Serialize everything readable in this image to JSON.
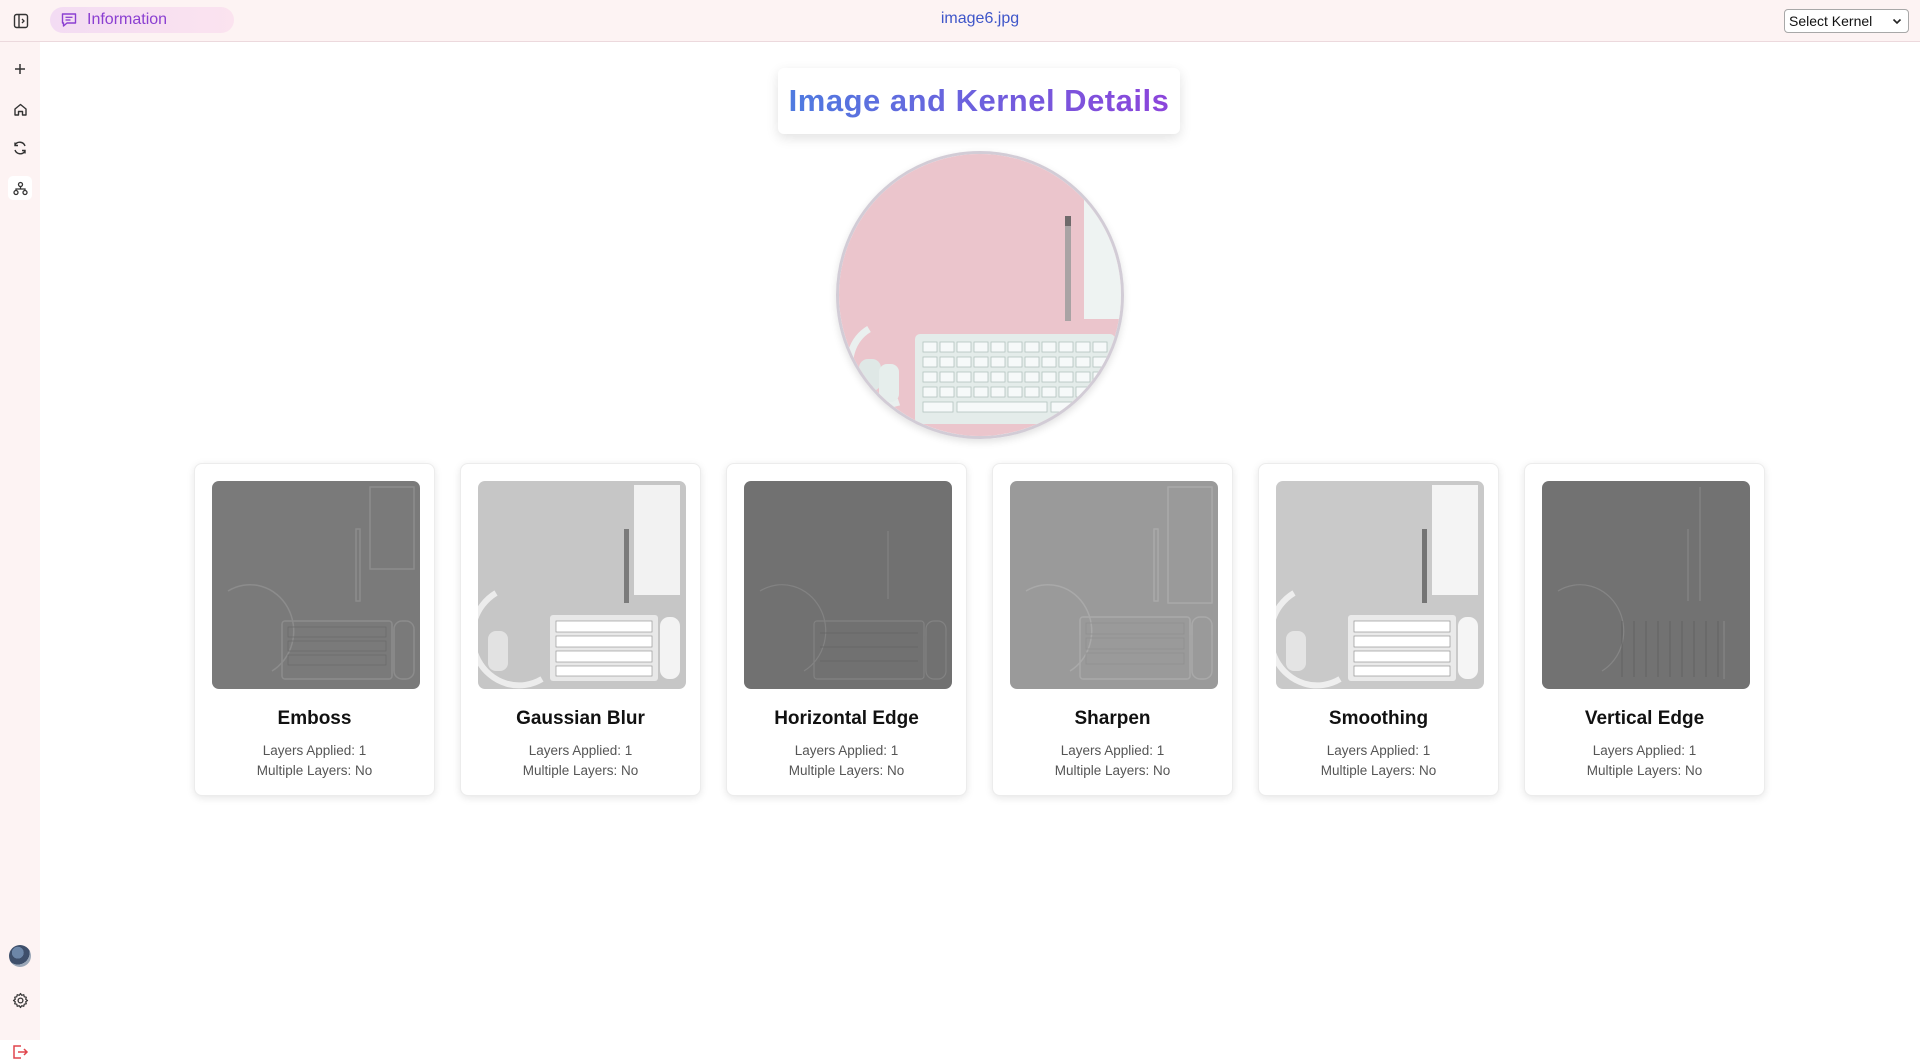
{
  "header": {
    "tab_label": "Information",
    "filename": "image6.jpg",
    "kernel_select": {
      "selected": "Select Kernel",
      "options": [
        "Select Kernel"
      ]
    }
  },
  "rail": {
    "items": [
      {
        "name": "new",
        "icon": "plus-icon"
      },
      {
        "name": "home",
        "icon": "home-icon"
      },
      {
        "name": "refresh",
        "icon": "refresh-icon"
      },
      {
        "name": "network",
        "icon": "network-icon"
      }
    ],
    "bottom": [
      {
        "name": "avatar",
        "icon": "avatar"
      },
      {
        "name": "settings",
        "icon": "gear-icon"
      },
      {
        "name": "logout",
        "icon": "logout-icon",
        "color": "#e0454d"
      }
    ]
  },
  "main": {
    "title": "Image and Kernel Details",
    "hero_image": "keyboard-headphones-pen-on-pink-desk"
  },
  "kernels": [
    {
      "name": "Emboss",
      "layers": "Layers Applied: 1",
      "multiple": "Multiple Layers: No",
      "tone": "emboss"
    },
    {
      "name": "Gaussian Blur",
      "layers": "Layers Applied: 1",
      "multiple": "Multiple Layers: No",
      "tone": "light"
    },
    {
      "name": "Horizontal Edge",
      "layers": "Layers Applied: 1",
      "multiple": "Multiple Layers: No",
      "tone": "dark"
    },
    {
      "name": "Sharpen",
      "layers": "Layers Applied: 1",
      "multiple": "Multiple Layers: No",
      "tone": "mid"
    },
    {
      "name": "Smoothing",
      "layers": "Layers Applied: 1",
      "multiple": "Multiple Layers: No",
      "tone": "light"
    },
    {
      "name": "Vertical Edge",
      "layers": "Layers Applied: 1",
      "multiple": "Multiple Layers: No",
      "tone": "dark"
    }
  ],
  "colors": {
    "accent": "#8b3fd1",
    "filename": "#3f56c9",
    "title_start": "#4f7be0",
    "title_end": "#8c45db",
    "bar_bg": "#fdf3f3"
  }
}
